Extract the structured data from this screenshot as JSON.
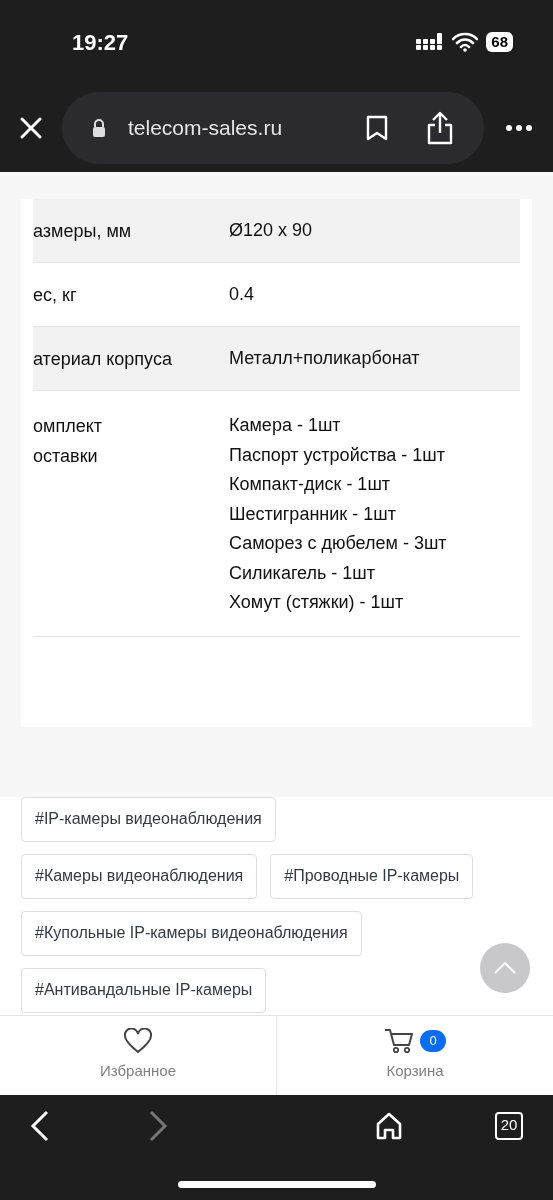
{
  "status_bar": {
    "time": "19:27",
    "battery": "68"
  },
  "browser": {
    "url": "telecom-sales.ru"
  },
  "specs": [
    {
      "label": [
        "азмеры, мм"
      ],
      "values": [
        "Ø120 x 90"
      ],
      "shaded": true
    },
    {
      "label": [
        "ес, кг"
      ],
      "values": [
        "0.4"
      ],
      "shaded": false
    },
    {
      "label": [
        "атериал корпуса"
      ],
      "values": [
        "Металл+поликарбонат"
      ],
      "shaded": true
    },
    {
      "label": [
        "омплект",
        "оставки"
      ],
      "values": [
        "Камера - 1шт",
        "Паспорт устройства - 1шт",
        "Компакт-диск - 1шт",
        "Шестигранник - 1шт",
        "Саморез с дюбелем - 3шт",
        "Силикагель - 1шт",
        "Хомут (стяжки) - 1шт"
      ],
      "shaded": false
    }
  ],
  "tags": [
    [
      "#IP-камеры видеонаблюдения"
    ],
    [
      "#Камеры видеонаблюдения",
      "#Проводные IP-камеры"
    ],
    [
      "#Купольные IP-камеры видеонаблюдения"
    ],
    [
      "#Антивандальные IP-камеры"
    ]
  ],
  "bottom_nav": [
    {
      "label": "Избранное",
      "kind": "favorites"
    },
    {
      "label": "Корзина",
      "kind": "cart",
      "badge": "0"
    }
  ],
  "toolbar": {
    "tabs_count": "20"
  }
}
